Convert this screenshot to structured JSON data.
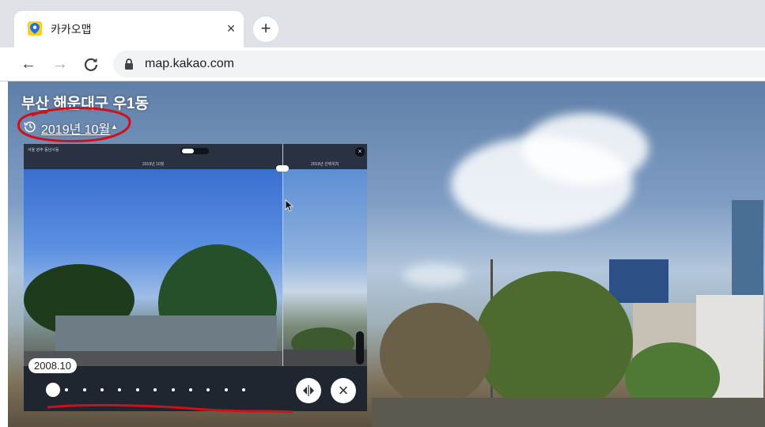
{
  "browser": {
    "tab_title": "카카오맵",
    "tab_close": "×",
    "new_tab": "+",
    "url": "map.kakao.com",
    "back": "←",
    "forward": "→",
    "reload": "C"
  },
  "roadview": {
    "place_title": "부산 해운대구 우1동",
    "date_selector": "2019년 10월",
    "caret": "▲"
  },
  "past_view": {
    "header_left": "서울 광주 동남사동",
    "date_left": "2019년 10월",
    "date_right": "2019년 선택위치",
    "selected_date": "2008.10",
    "timeline_steps": 12,
    "selected_index": 0,
    "compare_icon": "◂|▸",
    "close_icon": "×"
  },
  "colors": {
    "accent_yellow": "#f7d21c",
    "annotation_red": "#d0101a",
    "panel_bg": "#1f2630"
  }
}
